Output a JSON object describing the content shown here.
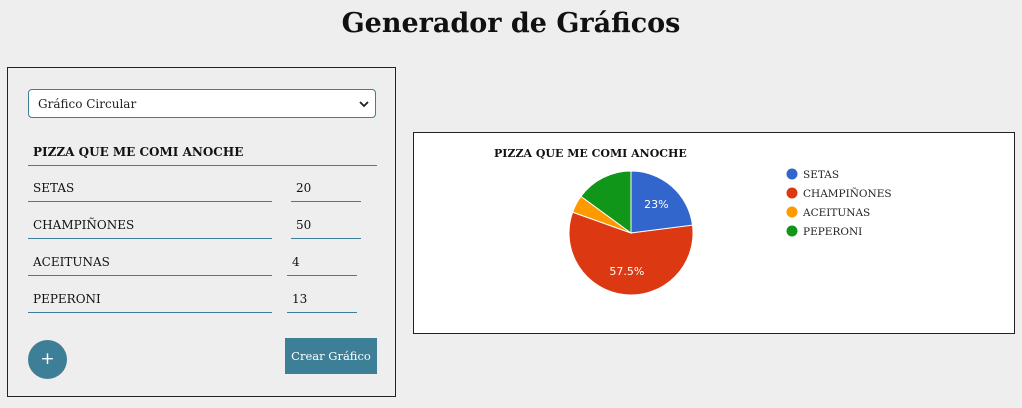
{
  "header": {
    "title": "Generador de Gráficos"
  },
  "form": {
    "chart_type_selected": "Gráfico Circular",
    "chart_title": "PIZZA QUE ME COMI ANOCHE",
    "rows": [
      {
        "label": "SETAS",
        "value": "20"
      },
      {
        "label": "CHAMPIÑONES",
        "value": "50"
      },
      {
        "label": "ACEITUNAS",
        "value": "4"
      },
      {
        "label": "PEPERONI",
        "value": "13"
      }
    ],
    "add_label": "+",
    "create_label": "Crear Gráfico"
  },
  "colors": {
    "accent": "#3e7f98",
    "page_background": "#eeeeee"
  },
  "chart_data": {
    "type": "pie",
    "title": "PIZZA QUE ME COMI ANOCHE",
    "categories": [
      "SETAS",
      "CHAMPIÑONES",
      "ACEITUNAS",
      "PEPERONI"
    ],
    "values": [
      20,
      50,
      4,
      13
    ],
    "colors": [
      "#3366cc",
      "#dc3912",
      "#ff9900",
      "#109618"
    ],
    "slice_labels": [
      "23%",
      "57.5%",
      "",
      ""
    ],
    "legend_position": "right"
  }
}
